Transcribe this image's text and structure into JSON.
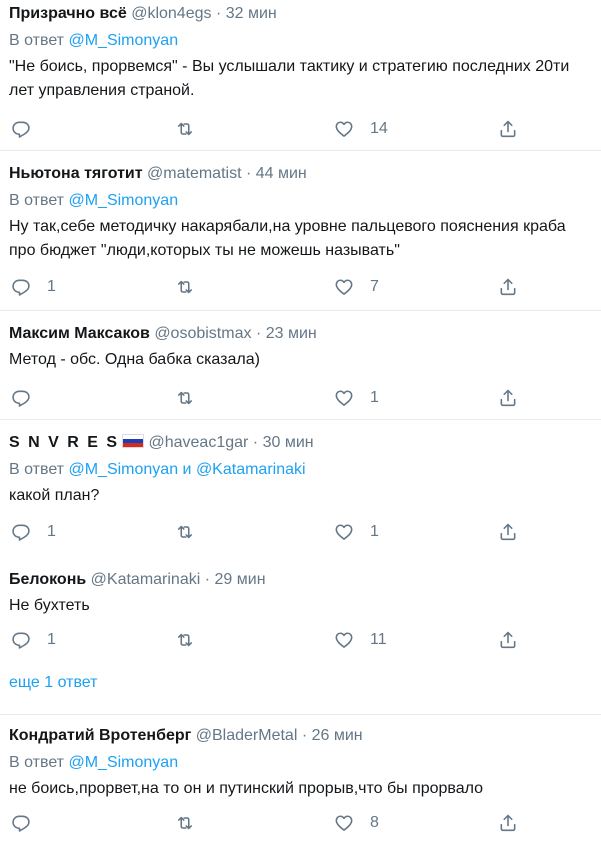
{
  "tweets": [
    {
      "name": "Призрачно всё",
      "handle": "@klon4egs",
      "dot": "·",
      "time": "32 мин",
      "reply_prefix": "В ответ",
      "reply_to": "@M_Simonyan",
      "reply_and": "",
      "reply_to2": "",
      "text": "\"Не боись, прорвемся\" - Вы услышали тактику и стратегию последних 20ти лет управления страной.",
      "replies": "",
      "likes": "14"
    },
    {
      "name": "Ньютона тяготит",
      "handle": "@matematist",
      "dot": "·",
      "time": "44 мин",
      "reply_prefix": "В ответ",
      "reply_to": "@M_Simonyan",
      "reply_and": "",
      "reply_to2": "",
      "text": "Ну так,себе методичку накарябали,на уровне пальцевого пояснения краба про бюджет \"люди,которых ты не можешь называть\"",
      "replies": "1",
      "likes": "7"
    },
    {
      "name": "Максим Максаков",
      "handle": "@osobistmax",
      "dot": "·",
      "time": "23 мин",
      "reply_prefix": "",
      "reply_to": "",
      "reply_and": "",
      "reply_to2": "",
      "text": "Метод - обс. Одна бабка сказала)",
      "replies": "",
      "likes": "1"
    },
    {
      "name": "S N V R E S",
      "handle": "@haveac1gar",
      "dot": "·",
      "time": "30 мин",
      "reply_prefix": "В ответ",
      "reply_to": "@M_Simonyan",
      "reply_and": "и",
      "reply_to2": "@Katamarinaki",
      "text": "какой план?",
      "replies": "1",
      "likes": "1"
    },
    {
      "name": "Белоконь",
      "handle": "@Katamarinaki",
      "dot": "·",
      "time": "29 мин",
      "reply_prefix": "",
      "reply_to": "",
      "reply_and": "",
      "reply_to2": "",
      "text": "Не бухтеть",
      "replies": "1",
      "likes": "11"
    },
    {
      "name": "Кондратий Вротенберг",
      "handle": "@BladerMetal",
      "dot": "·",
      "time": "26 мин",
      "reply_prefix": "В ответ",
      "reply_to": "@M_Simonyan",
      "reply_and": "",
      "reply_to2": "",
      "text": "не боись,прорвет,на то он и путинский прорыв,что бы прорвало",
      "replies": "",
      "likes": "8"
    }
  ],
  "more_replies": "еще 1 ответ",
  "icons": {
    "reply": "reply-icon",
    "retweet": "retweet-icon",
    "like": "heart-icon",
    "share": "share-icon",
    "flag": "russia-flag-icon"
  },
  "colors": {
    "link": "#1da1f2",
    "muted": "#657786",
    "text": "#14171a",
    "divider": "#e6ecf0"
  }
}
